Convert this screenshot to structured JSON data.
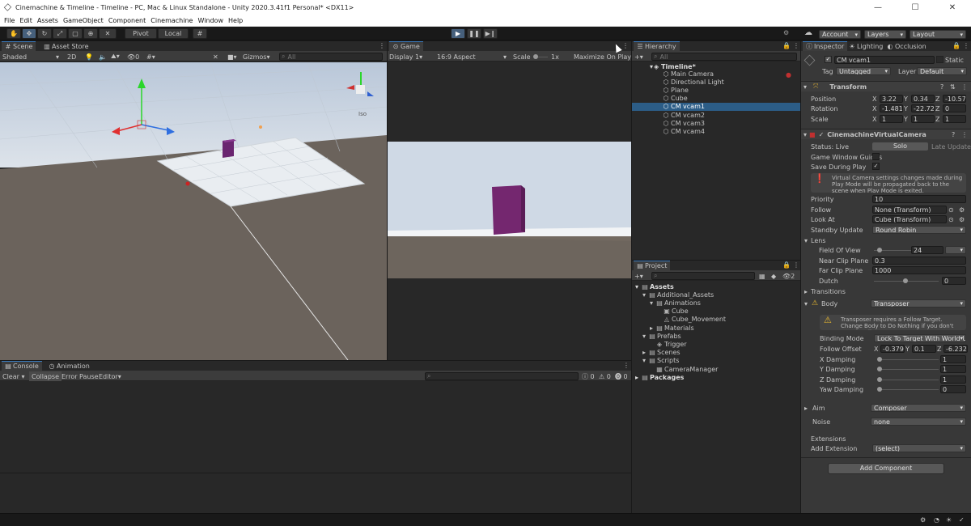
{
  "window": {
    "title": "Cinemachine & Timeline - Timeline - PC, Mac & Linux Standalone - Unity 2020.3.41f1 Personal* <DX11>",
    "min": "—",
    "max": "☐",
    "close": "✕"
  },
  "menu": [
    "File",
    "Edit",
    "Assets",
    "GameObject",
    "Component",
    "Cinemachine",
    "Window",
    "Help"
  ],
  "toolbar": {
    "pivot": "Pivot",
    "local": "Local",
    "account": "Account",
    "layers": "Layers",
    "layout": "Layout"
  },
  "scene": {
    "tab_scene": "Scene",
    "tab_store": "Asset Store",
    "shaded": "Shaded",
    "mode2d": "2D",
    "gizmos": "Gizmos",
    "search": "All",
    "iso": "Iso",
    "layers_count": "0"
  },
  "game": {
    "tab": "Game",
    "display": "Display 1",
    "aspect": "16:9 Aspect",
    "scale": "Scale",
    "scale_val": "1x",
    "maximize": "Maximize On Play"
  },
  "hierarchy": {
    "tab": "Hierarchy",
    "search": "All",
    "root": "Timeline*",
    "items": [
      "Main Camera",
      "Directional Light",
      "Plane",
      "Cube",
      "CM vcam1",
      "CM vcam2",
      "CM vcam3",
      "CM vcam4"
    ]
  },
  "project": {
    "tab": "Project",
    "badge": "2",
    "items": [
      {
        "label": "Assets",
        "d": 0,
        "ico": "▤",
        "bold": true
      },
      {
        "label": "Additional_Assets",
        "d": 1,
        "ico": "▤"
      },
      {
        "label": "Animations",
        "d": 2,
        "ico": "▤"
      },
      {
        "label": "Cube",
        "d": 3,
        "ico": "▣"
      },
      {
        "label": "Cube_Movement",
        "d": 3,
        "ico": "◬"
      },
      {
        "label": "Materials",
        "d": 2,
        "ico": "▤"
      },
      {
        "label": "Prefabs",
        "d": 1,
        "ico": "▤"
      },
      {
        "label": "Trigger",
        "d": 2,
        "ico": "◈"
      },
      {
        "label": "Scenes",
        "d": 1,
        "ico": "▤"
      },
      {
        "label": "Scripts",
        "d": 1,
        "ico": "▤"
      },
      {
        "label": "CameraManager",
        "d": 2,
        "ico": "▦"
      },
      {
        "label": "Packages",
        "d": 0,
        "ico": "▤",
        "bold": true
      }
    ]
  },
  "console": {
    "tab_console": "Console",
    "tab_anim": "Animation",
    "clear": "Clear",
    "collapse": "Collapse",
    "errorpause": "Error Pause",
    "editor": "Editor",
    "c1": "0",
    "c2": "0",
    "c3": "0"
  },
  "inspector": {
    "tab_insp": "Inspector",
    "tab_light": "Lighting",
    "tab_occ": "Occlusion",
    "name": "CM vcam1",
    "static": "Static",
    "tag": "Tag",
    "tag_val": "Untagged",
    "layer": "Layer",
    "layer_val": "Default",
    "transform": "Transform",
    "position": "Position",
    "rotation": "Rotation",
    "scale": "Scale",
    "pos": [
      "3.22",
      "0.34",
      "-10.57"
    ],
    "rot": [
      "-1.481",
      "-22.728",
      "0"
    ],
    "scl": [
      "1",
      "1",
      "1"
    ],
    "vcam": "CinemachineVirtualCamera",
    "status": "Status: Live",
    "solo": "Solo",
    "late": "Late Update",
    "guides": "Game Window Guides",
    "save": "Save During Play",
    "help1": "Virtual Camera settings changes made during Play Mode will be propagated back to the scene when Play Mode is exited.",
    "priority": "Priority",
    "priority_val": "10",
    "follow": "Follow",
    "follow_val": "None (Transform)",
    "lookat": "Look At",
    "lookat_val": "Cube (Transform)",
    "standby": "Standby Update",
    "standby_val": "Round Robin",
    "lens": "Lens",
    "fov": "Field Of View",
    "fov_val": "24",
    "near": "Near Clip Plane",
    "near_val": "0.3",
    "far": "Far Clip Plane",
    "far_val": "1000",
    "dutch": "Dutch",
    "dutch_val": "0",
    "transitions": "Transitions",
    "body": "Body",
    "body_val": "Transposer",
    "help2": "Transposer requires a Follow Target.  Change Body to Do Nothing if you don't want a Follow target.",
    "binding": "Binding Mode",
    "binding_val": "Lock To Target With World U",
    "offset": "Follow Offset",
    "off": [
      "-0.379",
      "0.1",
      "-6.232"
    ],
    "xd": "X Damping",
    "xd_val": "1",
    "yd": "Y Damping",
    "yd_val": "1",
    "zd": "Z Damping",
    "zd_val": "1",
    "yawd": "Yaw Damping",
    "yawd_val": "0",
    "aim": "Aim",
    "aim_val": "Composer",
    "noise": "Noise",
    "noise_val": "none",
    "ext": "Extensions",
    "addext": "Add Extension",
    "addext_val": "(select)",
    "addcomp": "Add Component",
    "x": "X",
    "y": "Y",
    "z": "Z"
  },
  "colors": {
    "accent": "#3a79bb",
    "selection": "#2c5d87",
    "cube": "#7b2a83"
  }
}
